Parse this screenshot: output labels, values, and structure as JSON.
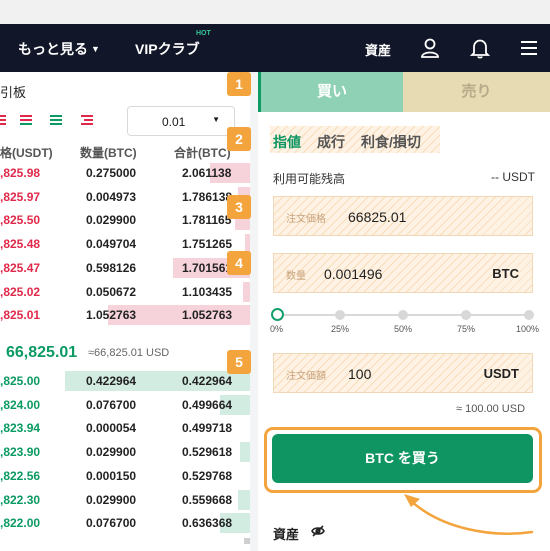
{
  "nav": {
    "more_label": "もっと見る",
    "vip_label": "VIPクラブ",
    "hot_badge": "HOT",
    "assets_label": "資産",
    "icons": [
      "user-icon",
      "bell-icon",
      "menu-icon"
    ]
  },
  "orderbook": {
    "title": "引板",
    "precision": "0.01",
    "headers": {
      "price": "格(USDT)",
      "qty": "数量(BTC)",
      "total": "合計(BTC)"
    },
    "asks": [
      {
        "price": ",825.98",
        "qty": "0.275000",
        "total": "2.061138",
        "depth": 0.16
      },
      {
        "price": ",825.97",
        "qty": "0.004973",
        "total": "1.786138",
        "depth": 0.05
      },
      {
        "price": ",825.50",
        "qty": "0.029900",
        "total": "1.781165",
        "depth": 0.06
      },
      {
        "price": ",825.48",
        "qty": "0.049704",
        "total": "1.751265",
        "depth": 0.02
      },
      {
        "price": ",825.47",
        "qty": "0.598126",
        "total": "1.701561",
        "depth": 0.31
      },
      {
        "price": ",825.02",
        "qty": "0.050672",
        "total": "1.103435",
        "depth": 0.03
      },
      {
        "price": ",825.01",
        "qty": "1.052763",
        "total": "1.052763",
        "depth": 0.57
      }
    ],
    "mid_price": "66,825.01",
    "mid_usd": "≈66,825.01 USD",
    "bids": [
      {
        "price": ",825.00",
        "qty": "0.422964",
        "total": "0.422964",
        "depth": 0.74
      },
      {
        "price": ",824.00",
        "qty": "0.076700",
        "total": "0.499664",
        "depth": 0.12
      },
      {
        "price": ",823.94",
        "qty": "0.000054",
        "total": "0.499718",
        "depth": 0.0
      },
      {
        "price": ",823.90",
        "qty": "0.029900",
        "total": "0.529618",
        "depth": 0.04
      },
      {
        "price": ",822.56",
        "qty": "0.000150",
        "total": "0.529768",
        "depth": 0.0
      },
      {
        "price": ",822.30",
        "qty": "0.029900",
        "total": "0.559668",
        "depth": 0.05
      },
      {
        "price": ",822.00",
        "qty": "0.076700",
        "total": "0.636368",
        "depth": 0.12
      }
    ]
  },
  "badges": [
    "1",
    "2",
    "3",
    "4",
    "5"
  ],
  "trade": {
    "tab_buy": "買い",
    "tab_sell": "売り",
    "order_types": [
      "指値",
      "成行",
      "利食/損切"
    ],
    "available_label": "利用可能残高",
    "available_value": "-- USDT",
    "price_field": {
      "label": "注文価格",
      "value": "66825.01"
    },
    "qty_field": {
      "label": "数量",
      "value": "0.001496",
      "unit": "BTC"
    },
    "slider": {
      "labels": [
        "0%",
        "25%",
        "50%",
        "75%",
        "100%"
      ],
      "value_percent": 0
    },
    "amount_field": {
      "label": "注文価額",
      "value": "100",
      "unit": "USDT"
    },
    "approx": "≈ 100.00 USD",
    "buy_button": "BTC を買う",
    "assets_label": "資産"
  },
  "colors": {
    "buy": "#0e9562",
    "sell_text": "#e0294a",
    "highlight": "#f3a43c",
    "nav_bg": "#121629"
  }
}
